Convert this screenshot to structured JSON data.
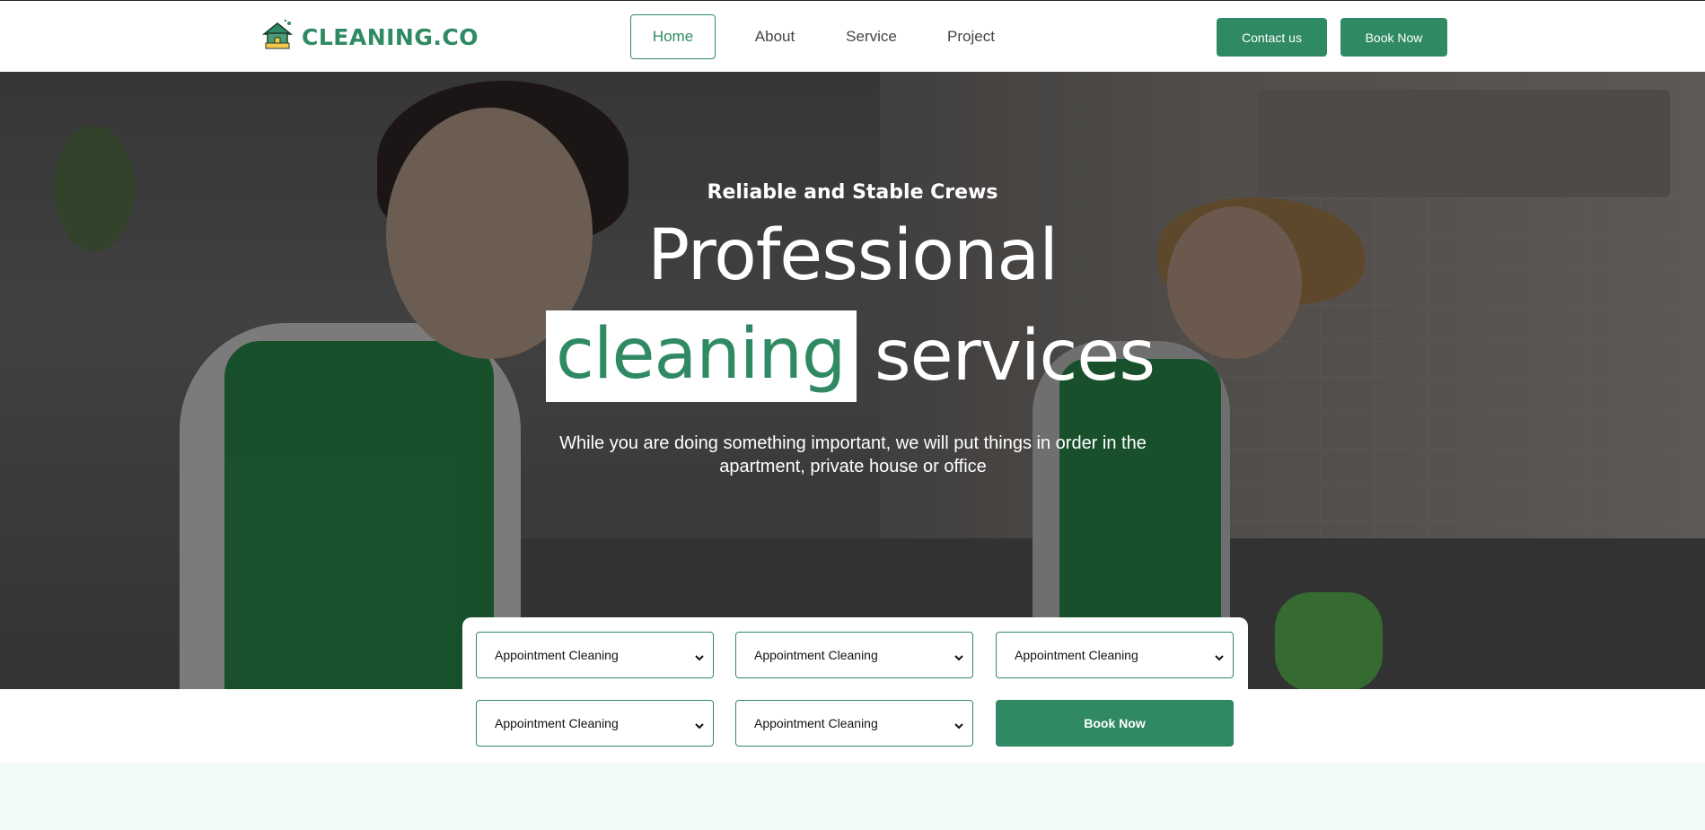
{
  "brand": {
    "name": "CLEANING.CO",
    "color": "#2f8a63"
  },
  "nav": {
    "items": [
      {
        "label": "Home",
        "active": true
      },
      {
        "label": "About"
      },
      {
        "label": "Service"
      },
      {
        "label": "Project"
      }
    ]
  },
  "header_actions": {
    "contact": "Contact us",
    "book": "Book Now"
  },
  "hero": {
    "subtitle": "Reliable and Stable Crews",
    "title_line1": "Professional",
    "title_highlight": "cleaning",
    "title_rest": "services",
    "description": "While you are doing something important, we will put things in order in the apartment, private house or office"
  },
  "booking": {
    "selects": [
      "Appointment Cleaning",
      "Appointment Cleaning",
      "Appointment Cleaning",
      "Appointment Cleaning",
      "Appointment Cleaning"
    ],
    "submit": "Book Now"
  },
  "icons": {
    "logo": "house-cleaning-logo-icon",
    "select": "chevron-down-icon"
  }
}
